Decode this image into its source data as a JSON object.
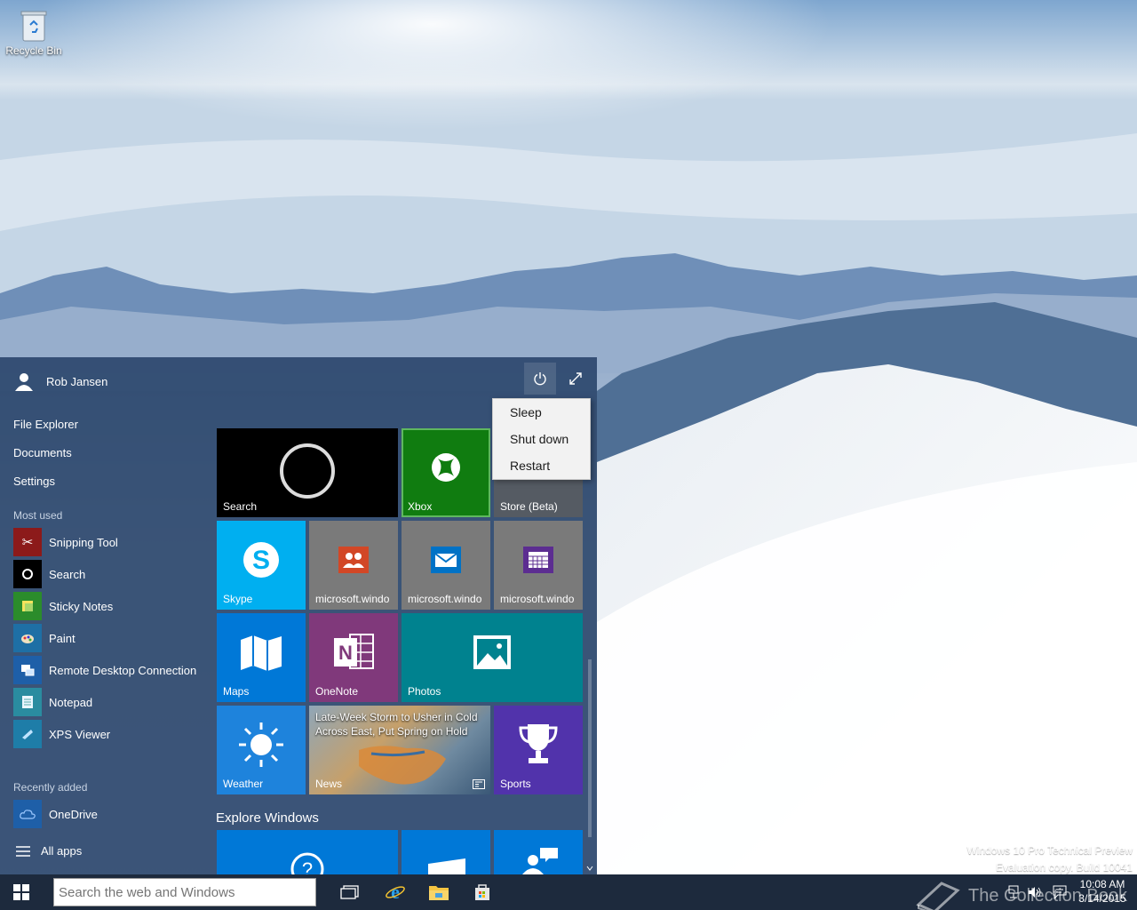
{
  "desktop": {
    "recycle_bin_label": "Recycle Bin"
  },
  "start_menu": {
    "user_name": "Rob Jansen",
    "nav": [
      "File Explorer",
      "Documents",
      "Settings"
    ],
    "most_used_header": "Most used",
    "most_used": [
      {
        "label": "Snipping Tool",
        "icon": "scissors-icon",
        "color": "#8c1a1a"
      },
      {
        "label": "Search",
        "icon": "search-circle-icon",
        "color": "#000000"
      },
      {
        "label": "Sticky Notes",
        "icon": "sticky-note-icon",
        "color": "#2b8c2b"
      },
      {
        "label": "Paint",
        "icon": "paint-palette-icon",
        "color": "#1e6fa5"
      },
      {
        "label": "Remote Desktop Connection",
        "icon": "remote-desktop-icon",
        "color": "#1e5fa8"
      },
      {
        "label": "Notepad",
        "icon": "notepad-icon",
        "color": "#2a8ca0"
      },
      {
        "label": "XPS Viewer",
        "icon": "xps-viewer-icon",
        "color": "#1e7da8"
      }
    ],
    "recently_added_header": "Recently added",
    "recently_added": [
      {
        "label": "OneDrive",
        "icon": "cloud-icon",
        "color": "#1e5fa8"
      }
    ],
    "all_apps_label": "All apps",
    "tiles": {
      "search": "Search",
      "xbox": "Xbox",
      "store": "Store (Beta)",
      "skype": "Skype",
      "people": "microsoft.windo",
      "mail": "microsoft.windo",
      "calendar": "microsoft.windo",
      "maps": "Maps",
      "onenote": "OneNote",
      "photos": "Photos",
      "weather": "Weather",
      "news": "News",
      "news_headline": "Late-Week Storm to Usher in Cold Across East, Put Spring on Hold",
      "sports": "Sports"
    },
    "explore_header": "Explore Windows",
    "colors": {
      "accent": "#0078d7",
      "xbox": "#107c10",
      "onenote": "#80397b",
      "teal": "#00828f"
    }
  },
  "power_menu": {
    "items": [
      "Sleep",
      "Shut down",
      "Restart"
    ]
  },
  "watermark": {
    "line1": "Windows 10 Pro Technical Preview",
    "line2": "Evaluation copy. Build 10041"
  },
  "taskbar": {
    "search_placeholder": "Search the web and Windows",
    "clock_time": "10:08 AM",
    "clock_date": "3/14/2015",
    "overlay_text": "The Collection Book"
  }
}
